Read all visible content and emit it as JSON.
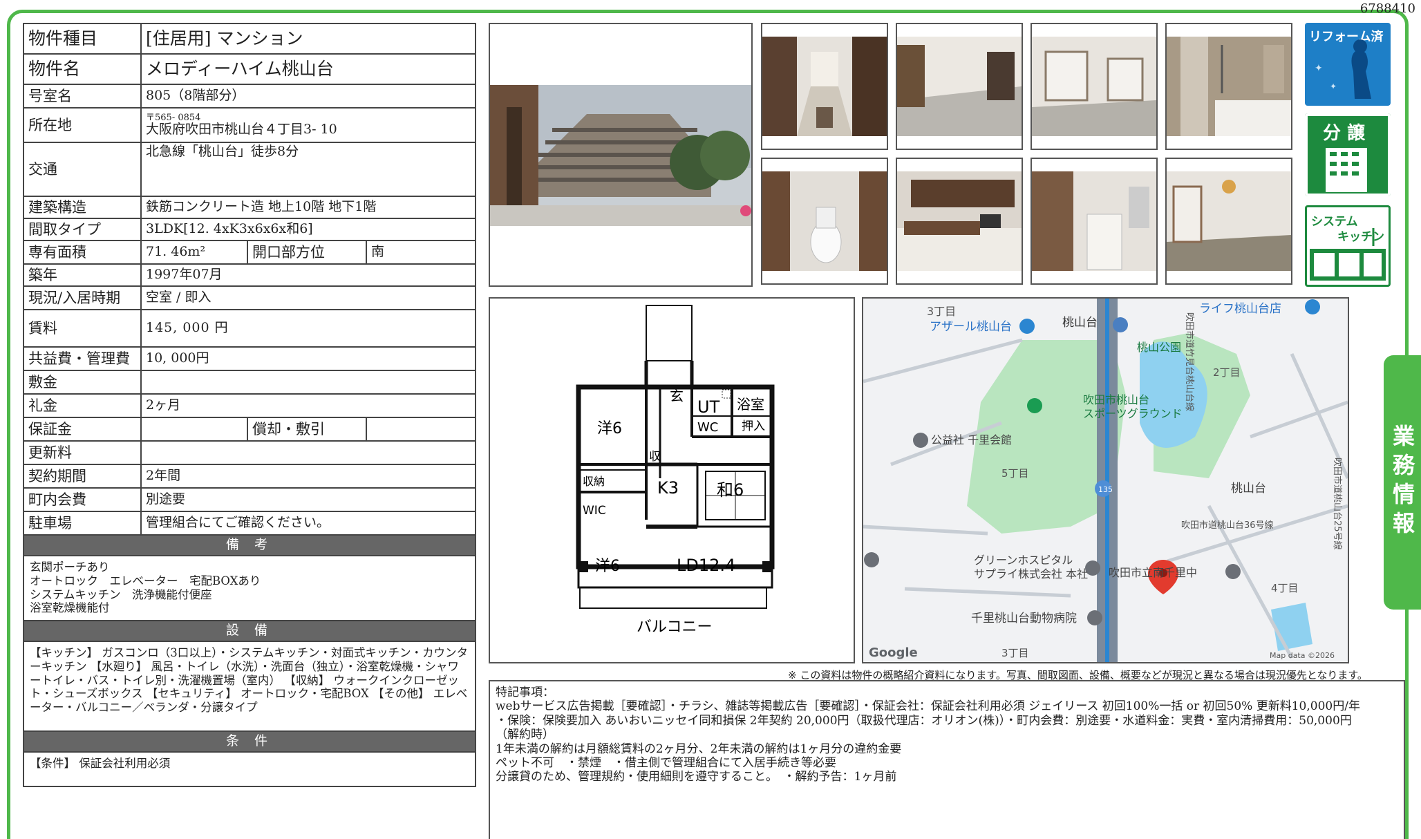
{
  "doc_id": "6788410",
  "property": {
    "type_label": "物件種目",
    "type_value": "[住居用]  マンション",
    "name_label": "物件名",
    "name_value": "メロディーハイム桃山台",
    "room_label": "号室名",
    "room_value": "805（8階部分）",
    "address_label": "所在地",
    "zip": "〒565- 0854",
    "address_value": "大阪府吹田市桃山台４丁目3- 10",
    "access_label": "交通",
    "access_value": "北急線「桃山台」徒歩8分",
    "structure_label": "建築構造",
    "structure_value": "鉄筋コンクリート造  地上10階  地下1階",
    "layout_label": "間取タイプ",
    "layout_value": "3LDK[12. 4xK3x6x6x和6]",
    "area_label": "専有面積",
    "area_value": "71. 46m²",
    "direction_label": "開口部方位",
    "direction_value": "南",
    "built_label": "築年",
    "built_value": "1997年07月",
    "status_label": "現況/入居時期",
    "status_value": "空室  /  即入",
    "rent_label": "賃料",
    "rent_value": "145, 000  円",
    "fee_label": "共益費・管理費",
    "fee_value": "10, 000円",
    "deposit_label": "敷金",
    "deposit_value": "",
    "key_money_label": "礼金",
    "key_money_value": "2ヶ月",
    "security_label": "保証金",
    "security_value": "",
    "amort_label": "償却・敷引",
    "amort_value": "",
    "renewal_label": "更新料",
    "renewal_value": "",
    "contract_label": "契約期間",
    "contract_value": "2年間",
    "assoc_label": "町内会費",
    "assoc_value": "別途要",
    "parking_label": "駐車場",
    "parking_value": "管理組合にてご確認ください。"
  },
  "remarks": {
    "heading": "備 考",
    "lines": [
      "玄関ポーチあり",
      "オートロック　エレベーター　宅配BOXあり",
      "システムキッチン　洗浄機能付便座",
      "浴室乾燥機能付"
    ]
  },
  "facilities": {
    "heading": "設 備",
    "text": "【キッチン】 ガスコンロ（3口以上）・システムキッチン・対面式キッチン・カウンターキッチン 【水廻り】 風呂・トイレ（水洗）・洗面台（独立）・浴室乾燥機・シャワートイレ・バス・トイレ別・洗濯機置場（室内） 【収納】 ウォークインクローゼット・シューズボックス 【セキュリティ】 オートロック・宅配BOX 【その他】 エレベーター・バルコニー／ベランダ・分譲タイプ"
  },
  "conditions": {
    "heading": "条 件",
    "text": "【条件】 保証会社利用必須"
  },
  "badges": {
    "reform": "リフォーム済",
    "bunjo": "分 譲",
    "kitchen_line1": "システム",
    "kitchen_line2": "キッチン"
  },
  "side_tab": "業務情報",
  "floorplan": {
    "rooms": [
      "洋6",
      "玄",
      "UT",
      "浴室",
      "WC",
      "押入",
      "収",
      "収納",
      "K3",
      "和6",
      "WIC",
      "洋6",
      "LD12.4",
      "バルコニー"
    ]
  },
  "map": {
    "labels": {
      "chome3_top": "3丁目",
      "azeal": "アザール桃山台",
      "station": "桃山台",
      "life": "ライフ桃山台店",
      "park": "桃山公園",
      "road_north": "吹田市道竹見台桃山台線",
      "chome2": "2丁目",
      "ground1": "吹田市桃山台",
      "ground2": "スポーツグラウンド",
      "senri_hall": "公益社 千里会館",
      "chome5": "5丁目",
      "route": "135",
      "momoyamadai": "桃山台",
      "road36": "吹田市道桃山台36号線",
      "road25": "吹田市道桃山台25号線",
      "green1": "グリーンホスピタル",
      "green2": "サプライ株式会社 本社",
      "school": "吹田市立南千里中",
      "chome4": "4丁目",
      "animal": "千里桃山台動物病院",
      "chome3_bottom": "3丁目",
      "google": "Google",
      "mapdata": "Map data ©2026"
    }
  },
  "disclaimer": "※ この資料は物件の概略紹介資料になります。写真、間取図面、設備、概要などが現況と異なる場合は現況優先となります。",
  "special": {
    "lines": [
      "特記事項：",
      "webサービス広告掲載［要確認］・チラシ、雑誌等掲載広告［要確認］・保証会社：保証会社利用必須 ジェイリース 初回100%一括 or 初回50% 更新料10,000円/年",
      "・保険：保険要加入 あいおいニッセイ同和損保 2年契約 20,000円（取扱代理店：オリオン(株)）・町内会費：別途要・水道料金：実費・室内清掃費用：50,000円",
      "（解約時）",
      "1年未満の解約は月額総賃料の2ヶ月分、2年未満の解約は1ヶ月分の違約金要",
      "ペット不可　・禁煙　・借主側で管理組合にて入居手続き等必要",
      "分譲貸のため、管理規約・使用細則を遵守すること。　・解約予告：1ヶ月前"
    ]
  }
}
